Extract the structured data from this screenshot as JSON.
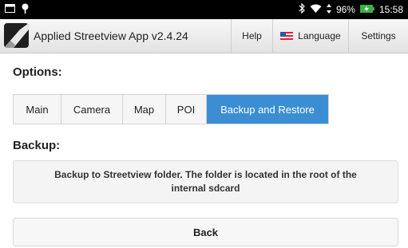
{
  "statusbar": {
    "battery_percent": "96%",
    "time": "15:58",
    "icons": [
      "window-icon",
      "location-pin-icon",
      "bluetooth-icon",
      "wifi-icon",
      "battery-charging-icon"
    ]
  },
  "titlebar": {
    "app_title": "Applied Streetview App v2.4.24",
    "help_label": "Help",
    "language_label": "Language",
    "settings_label": "Settings"
  },
  "options": {
    "heading": "Options:",
    "tabs": [
      {
        "label": "Main",
        "active": false
      },
      {
        "label": "Camera",
        "active": false
      },
      {
        "label": "Map",
        "active": false
      },
      {
        "label": "POI",
        "active": false
      },
      {
        "label": "Backup and Restore",
        "active": true
      }
    ]
  },
  "backup": {
    "heading": "Backup:",
    "message": "Backup to Streetview folder. The folder is located in the root of the internal sdcard",
    "back_label": "Back"
  },
  "colors": {
    "active_tab": "#3b8ed4",
    "status_bar": "#000000",
    "battery": "#3cb043"
  }
}
